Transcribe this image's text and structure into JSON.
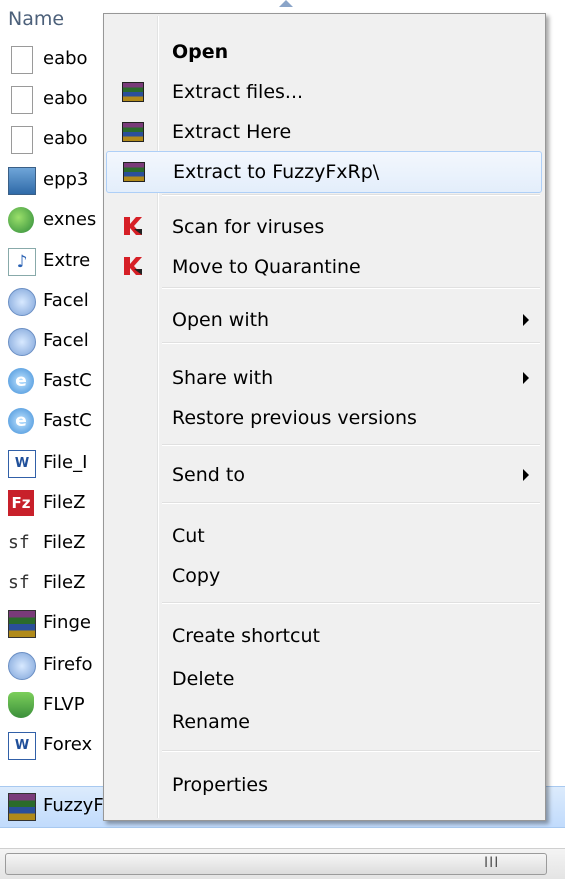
{
  "explorer": {
    "column_header": "Name",
    "files": [
      {
        "name": "eabo",
        "icon": "document-icon"
      },
      {
        "name": "eabo",
        "icon": "document-icon"
      },
      {
        "name": "eabo",
        "icon": "document-icon"
      },
      {
        "name": "epp3",
        "icon": "exe-icon"
      },
      {
        "name": "exnes",
        "icon": "globe-icon"
      },
      {
        "name": "Extre",
        "icon": "audio-file-icon"
      },
      {
        "name": "Facel",
        "icon": "setup-icon"
      },
      {
        "name": "Facel",
        "icon": "setup-icon"
      },
      {
        "name": "FastC",
        "icon": "ie-icon"
      },
      {
        "name": "FastC",
        "icon": "ie-icon"
      },
      {
        "name": "File_I",
        "icon": "word-doc-icon"
      },
      {
        "name": "FileZ",
        "icon": "filezilla-icon"
      },
      {
        "name": "FileZ",
        "icon": "sf-icon"
      },
      {
        "name": "FileZ",
        "icon": "sf-icon"
      },
      {
        "name": "Finge",
        "icon": "winrar-icon"
      },
      {
        "name": "Firefo",
        "icon": "setup-icon"
      },
      {
        "name": "FLVP",
        "icon": "shield-icon"
      },
      {
        "name": "Forex",
        "icon": "word-doc-icon"
      },
      {
        "name": "FuzzyFxRp",
        "icon": "winrar-icon",
        "selected": true
      }
    ],
    "hscroll_grip": "III"
  },
  "context_menu": {
    "items": [
      {
        "label": "Open",
        "bold": true
      },
      {
        "label": "Extract files...",
        "icon": "winrar-icon"
      },
      {
        "label": "Extract Here",
        "icon": "winrar-icon"
      },
      {
        "label": "Extract to FuzzyFxRp\\",
        "icon": "winrar-icon",
        "hover": true
      },
      {
        "separator": true
      },
      {
        "label": "Scan for viruses",
        "icon": "kaspersky-icon"
      },
      {
        "label": "Move to Quarantine",
        "icon": "kaspersky-icon"
      },
      {
        "separator": true
      },
      {
        "label": "Open with",
        "submenu": true
      },
      {
        "separator": true
      },
      {
        "label": "Share with",
        "submenu": true
      },
      {
        "label": "Restore previous versions"
      },
      {
        "separator": true
      },
      {
        "label": "Send to",
        "submenu": true
      },
      {
        "separator": true
      },
      {
        "label": "Cut"
      },
      {
        "label": "Copy"
      },
      {
        "separator": true
      },
      {
        "label": "Create shortcut"
      },
      {
        "label": "Delete"
      },
      {
        "label": "Rename"
      },
      {
        "separator": true
      },
      {
        "label": "Properties"
      }
    ]
  },
  "colors": {
    "menu_background": "#f0f0f0",
    "hover_border": "#aecff7",
    "selection_fill": "#c1dbfc",
    "header_text": "#4c607a"
  }
}
